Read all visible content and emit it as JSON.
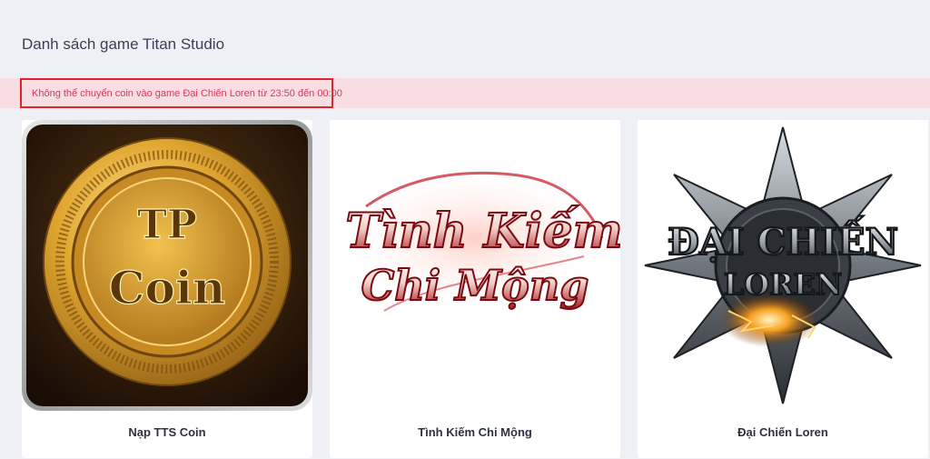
{
  "page": {
    "title": "Danh sách game Titan Studio"
  },
  "alert": {
    "message": "Không thể chuyển coin vào game Đại Chiến Loren từ 23:50 đến 00:00"
  },
  "games": [
    {
      "name": "Nạp TTS Coin",
      "logo_line1": "TP",
      "logo_line2": "Coin",
      "icon": "gold-coin-icon"
    },
    {
      "name": "Tình Kiếm Chi Mộng",
      "logo_line1": "Tình Kiếm",
      "logo_line2": "Chi Mộng",
      "icon": "calligraphy-logo"
    },
    {
      "name": "Đại Chiến Loren",
      "logo_line1": "ĐẠI CHIẾN",
      "logo_line2": "LOREN",
      "icon": "compass-star-emblem"
    }
  ],
  "colors": {
    "background": "#eef0f5",
    "alert_bg": "#f8dde3",
    "alert_border": "#e0242e",
    "alert_text": "#d63a55"
  }
}
